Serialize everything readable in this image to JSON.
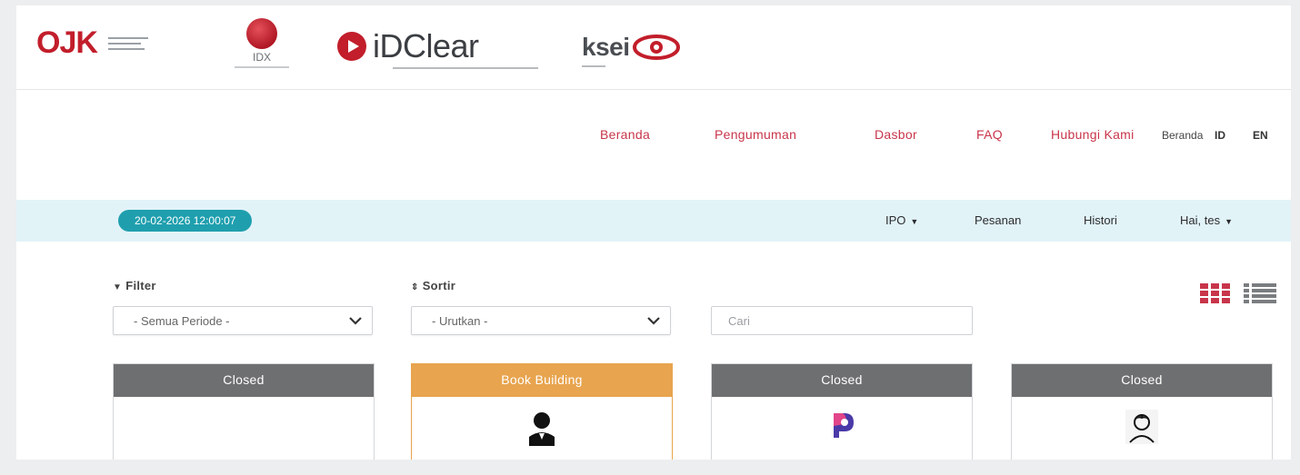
{
  "logos": {
    "ojk": "OJK",
    "idx": "IDX",
    "idclear": "iDClear",
    "ksei": "ksei"
  },
  "topnav": {
    "items": [
      "Beranda",
      "Pengumuman",
      "Dasbor",
      "FAQ",
      "Hubungi Kami"
    ],
    "lang_overlay": "Beranda",
    "lang_id": "ID",
    "lang_en": "EN"
  },
  "session": {
    "datetime": "20-02-2026 12:00:07"
  },
  "menu": {
    "ipo": "IPO",
    "pesanan": "Pesanan",
    "histori": "Histori",
    "user": "Hai, tes"
  },
  "filters": {
    "filter_label": "Filter",
    "filter_value": "- Semua Periode -",
    "sort_label": "Sortir",
    "sort_value": "- Urutkan -",
    "search_placeholder": "Cari"
  },
  "cards": [
    {
      "status": "Closed",
      "state": "closed"
    },
    {
      "status": "Book Building",
      "state": "building"
    },
    {
      "status": "Closed",
      "state": "closed"
    },
    {
      "status": "Closed",
      "state": "closed"
    }
  ],
  "colors": {
    "brand_red": "#c8354a",
    "teal": "#1f9fae",
    "closed_gray": "#6e6f71",
    "building_orange": "#e8a44e",
    "bar_blue": "#e2f3f8"
  },
  "icons": [
    "filter-icon",
    "sort-icon",
    "chevron-down-icon",
    "grid-view-icon",
    "list-view-icon",
    "caret-down-icon"
  ]
}
